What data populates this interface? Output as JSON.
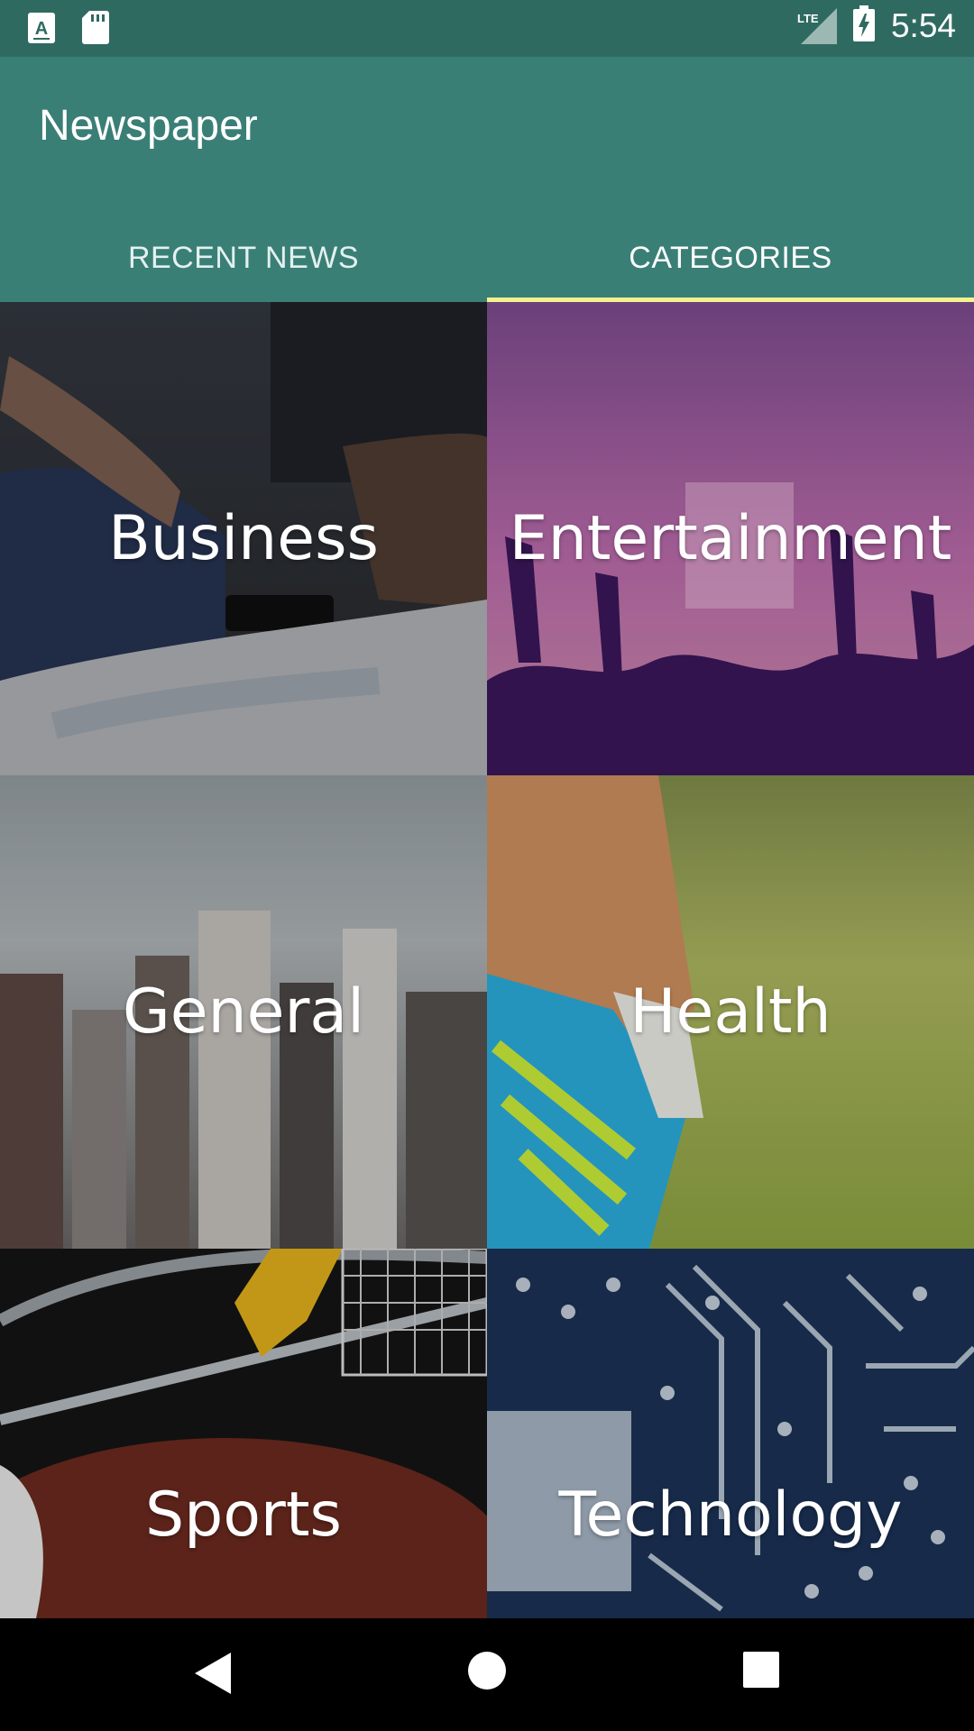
{
  "status_bar": {
    "time": "5:54",
    "network_label": "LTE",
    "icons": [
      "text-notification-icon",
      "sd-card-icon",
      "lte-signal-icon",
      "battery-charging-icon"
    ]
  },
  "app_bar": {
    "title": "Newspaper"
  },
  "tabs": [
    {
      "label": "RECENT NEWS",
      "selected": false
    },
    {
      "label": "CATEGORIES",
      "selected": true
    }
  ],
  "colors": {
    "status_bar": "#2f6a61",
    "app_bar": "#3a7f76",
    "tab_indicator": "#f6f18f"
  },
  "categories": [
    {
      "label": "Business"
    },
    {
      "label": "Entertainment"
    },
    {
      "label": "General"
    },
    {
      "label": "Health"
    },
    {
      "label": "Sports"
    },
    {
      "label": "Technology"
    }
  ],
  "nav_bar": {
    "buttons": [
      "back-icon",
      "home-icon",
      "recents-icon"
    ]
  }
}
